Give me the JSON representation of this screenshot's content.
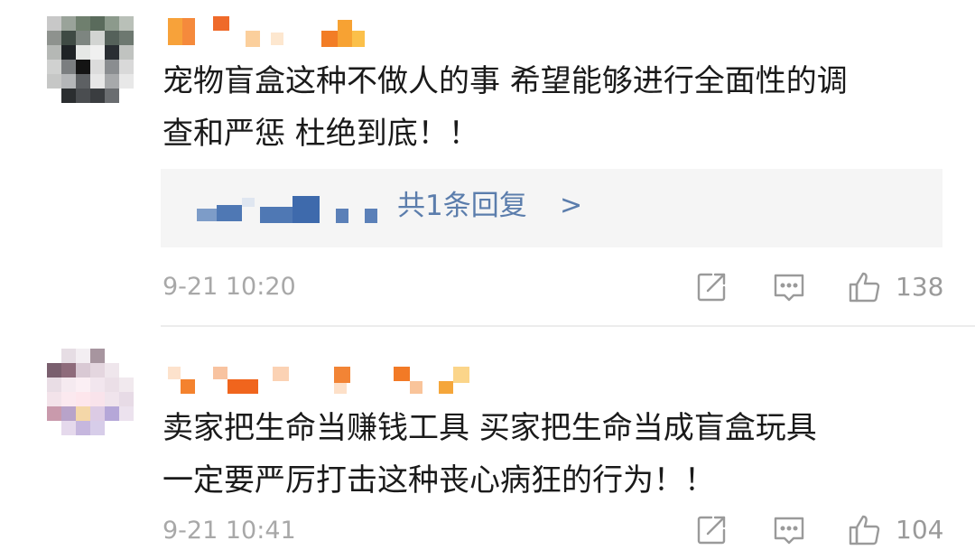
{
  "comments": [
    {
      "text": "宠物盲盒这种不做人的事 希望能够进行全面性的调\n查和严惩 杜绝到底！！",
      "reply_count": "共1条回复",
      "reply_arrow": ">",
      "time": "9-21 10:20",
      "likes": "138"
    },
    {
      "text": "卖家把生命当赚钱工具 买家把生命当成盲盒玩具\n一定要严厉打击这种丧心病狂的行为！！",
      "time": "9-21 10:41",
      "likes": "104"
    }
  ],
  "colors": {
    "link": "#5b7dac",
    "text": "#1a1a1a",
    "meta": "#a8a8a8",
    "reply_bg": "#f5f5f5"
  },
  "icons": [
    "share-icon",
    "comment-icon",
    "like-icon"
  ]
}
